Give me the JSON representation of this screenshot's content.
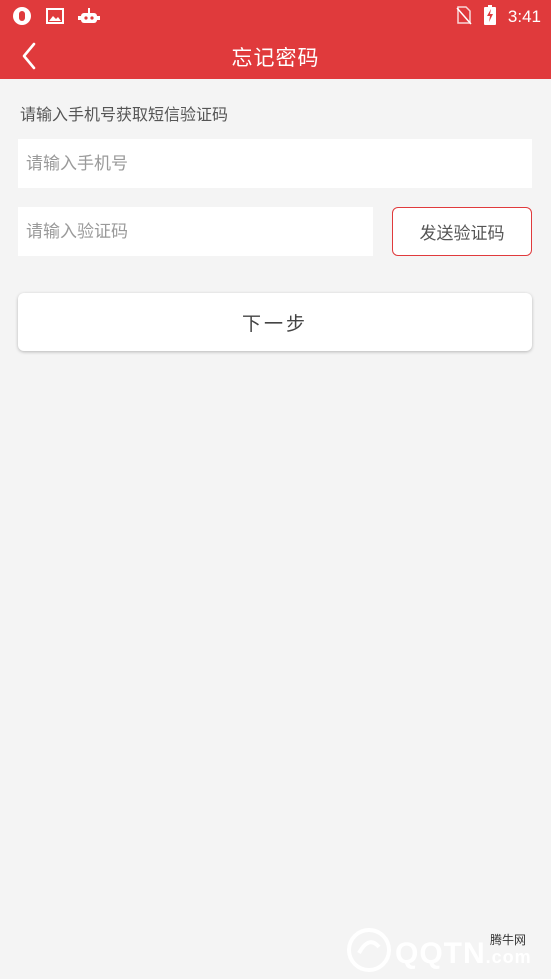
{
  "status_bar": {
    "time": "3:41"
  },
  "header": {
    "title": "忘记密码"
  },
  "form": {
    "hint": "请输入手机号获取短信验证码",
    "phone_placeholder": "请输入手机号",
    "code_placeholder": "请输入验证码",
    "send_code_label": "发送验证码",
    "next_label": "下一步"
  },
  "watermark": {
    "brand": "QQTN",
    "suffix": ".com",
    "tag": "腾牛网"
  },
  "colors": {
    "accent": "#e03a3c",
    "background": "#f4f4f4"
  }
}
